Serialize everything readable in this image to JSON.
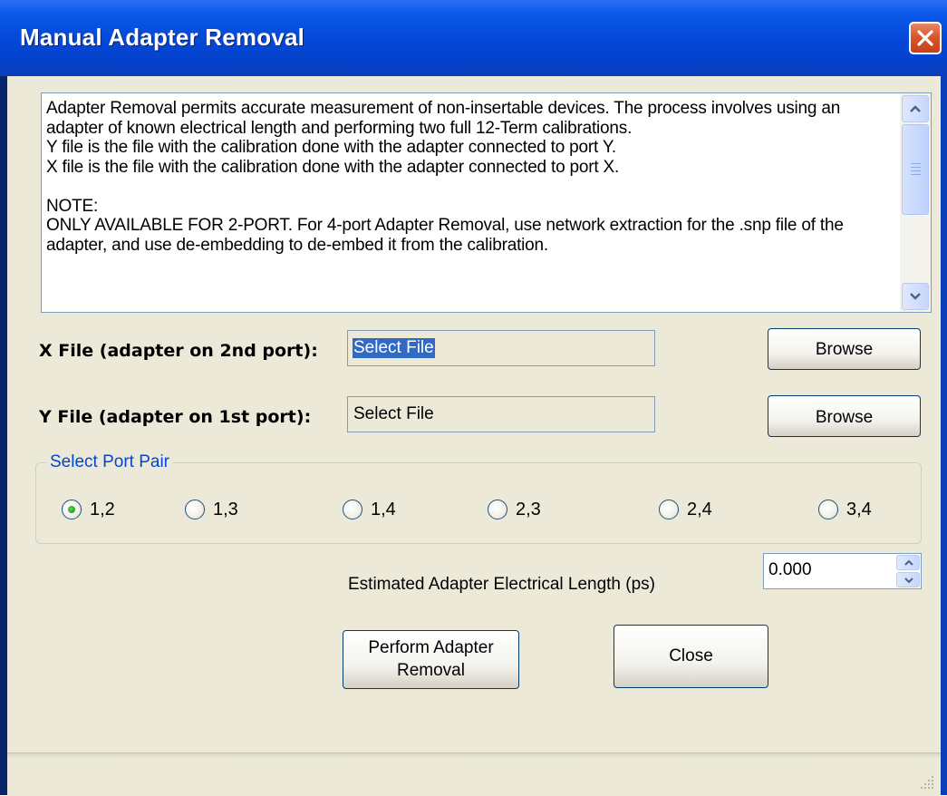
{
  "window": {
    "title": "Manual Adapter Removal",
    "close_icon": "close-icon"
  },
  "description": {
    "text": "Adapter Removal permits accurate measurement of non-insertable devices.  The process involves using an adapter of known electrical length and performing two full 12-Term calibrations.\nY file is the file with the calibration done with the adapter connected to port Y.\nX file is the file with the calibration done with the adapter connected to port X.\n\nNOTE:\nONLY AVAILABLE FOR 2-PORT. For 4-port Adapter Removal, use network extraction for the .snp file of the adapter, and use de-embedding to de-embed it from the calibration."
  },
  "x_file": {
    "label": "X File (adapter on 2nd port):",
    "value": "Select File",
    "browse_label": "Browse"
  },
  "y_file": {
    "label": "Y File (adapter on 1st port):",
    "value": "Select File",
    "browse_label": "Browse"
  },
  "port_pair": {
    "legend": "Select Port Pair",
    "options": [
      "1,2",
      "1,3",
      "1,4",
      "2,3",
      "2,4",
      "3,4"
    ],
    "selected": "1,2"
  },
  "electrical_length": {
    "label": "Estimated Adapter Electrical Length (ps)",
    "value": "0.000"
  },
  "actions": {
    "perform_line1": "Perform Adapter",
    "perform_line2": "Removal",
    "close_label": "Close"
  },
  "colors": {
    "titlebar": "#0547d6",
    "client_bg": "#ece9d8",
    "group_legend": "#0046d5",
    "selection": "#316ac5"
  }
}
